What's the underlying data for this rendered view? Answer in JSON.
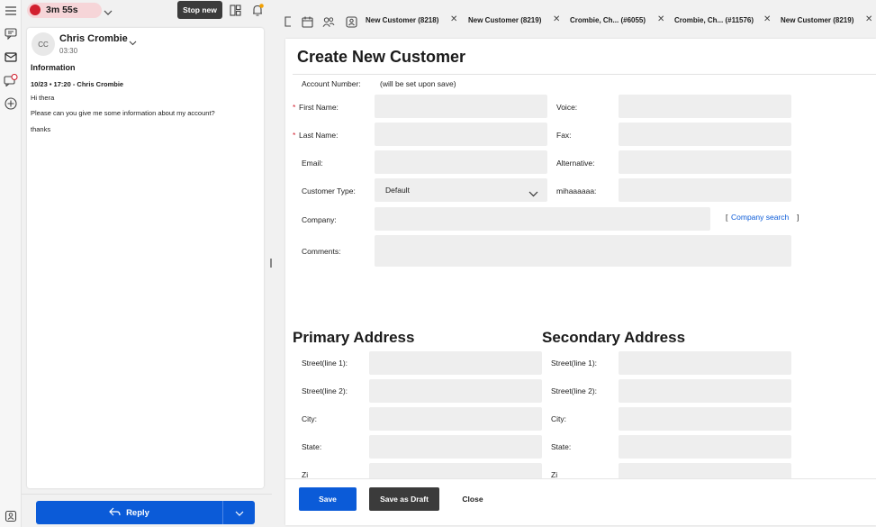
{
  "topbar": {
    "timer": "3m 55s",
    "stop_button": "Stop new"
  },
  "colors": {
    "accent": "#0b5bd8",
    "timer_dot": "#d2202f",
    "timer_bg": "#f6d5d8",
    "dark_button": "#3b3b3b"
  },
  "conversation": {
    "avatar_initials": "CC",
    "contact_name": "Chris Crombie",
    "time": "03:30",
    "section_title": "Information",
    "meta": "10/23 • 17:20 - Chris Crombie",
    "messages": [
      "Hi thera",
      "Please can you give me some information about my account?",
      "thanks"
    ]
  },
  "reply": {
    "label": "Reply"
  },
  "tabs": [
    {
      "label": "New Customer (8218)"
    },
    {
      "label": "New Customer (8219)"
    },
    {
      "label": "Crombie, Ch... (#6055)"
    },
    {
      "label": "Crombie, Ch... (#11576)"
    },
    {
      "label": "New Customer (8219)"
    }
  ],
  "form": {
    "title": "Create New Customer",
    "account_number_label": "Account Number:",
    "account_number_value": "(will be set upon save)",
    "first_name_label": "First Name:",
    "last_name_label": "Last Name:",
    "email_label": "Email:",
    "customer_type_label": "Customer Type:",
    "customer_type_value": "Default",
    "company_label": "Company:",
    "comments_label": "Comments:",
    "voice_label": "Voice:",
    "fax_label": "Fax:",
    "alternative_label": "Alternative:",
    "custom_label": "mihaaaaaa:",
    "company_search_open": "[",
    "company_search_link": "Company search",
    "company_search_close": "]",
    "required_mark": "*",
    "primary_title": "Primary Address",
    "secondary_title": "Secondary Address",
    "street1_label": "Street(line 1):",
    "street2_label": "Street(line 2):",
    "city_label": "City:",
    "state_label": "State:",
    "zip_label_partial": "Zi"
  },
  "footer": {
    "save": "Save",
    "save_draft": "Save as Draft",
    "close": "Close"
  }
}
